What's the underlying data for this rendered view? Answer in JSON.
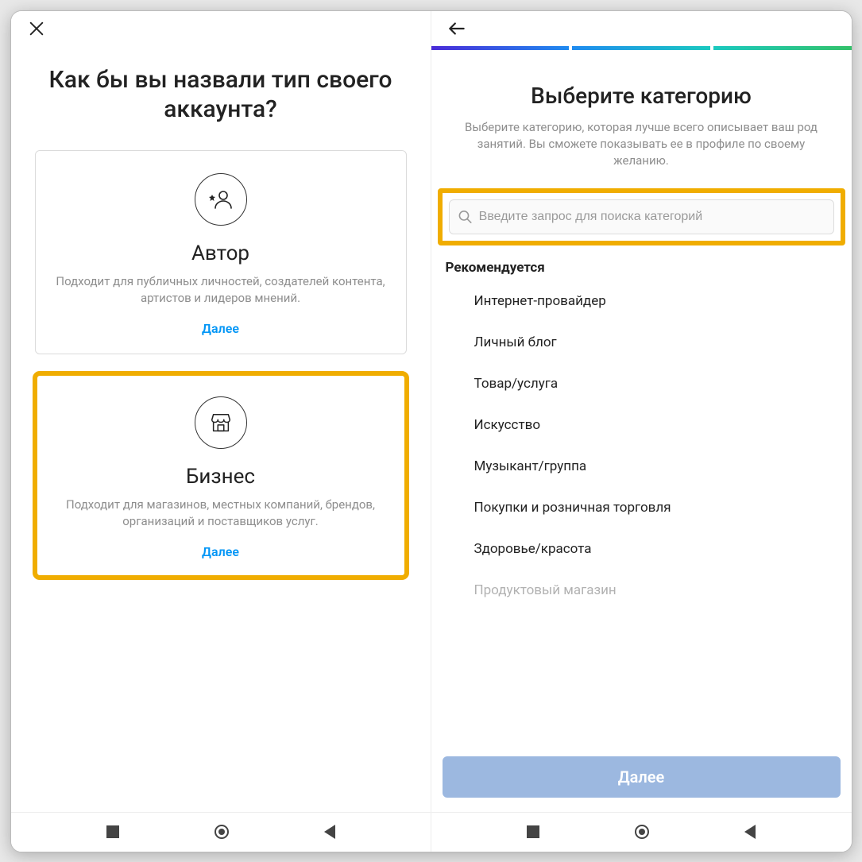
{
  "left": {
    "title": "Как бы вы назвали тип своего аккаунта?",
    "cards": [
      {
        "title": "Автор",
        "desc": "Подходит для публичных личностей, создателей контента, артистов и лидеров мнений.",
        "cta": "Далее"
      },
      {
        "title": "Бизнес",
        "desc": "Подходит для магазинов, местных компаний, брендов, организаций и поставщиков услуг.",
        "cta": "Далее"
      }
    ]
  },
  "right": {
    "title": "Выберите категорию",
    "subtitle": "Выберите категорию, которая лучше всего описывает ваш род занятий. Вы сможете показывать ее в профиле по своему желанию.",
    "search_placeholder": "Введите запрос для поиска категорий",
    "recommend_label": "Рекомендуется",
    "categories": [
      "Интернет-провайдер",
      "Личный блог",
      "Товар/услуга",
      "Искусство",
      "Музыкант/группа",
      "Покупки и розничная торговля",
      "Здоровье/красота",
      "Продуктовый магазин"
    ],
    "next_button": "Далее"
  }
}
